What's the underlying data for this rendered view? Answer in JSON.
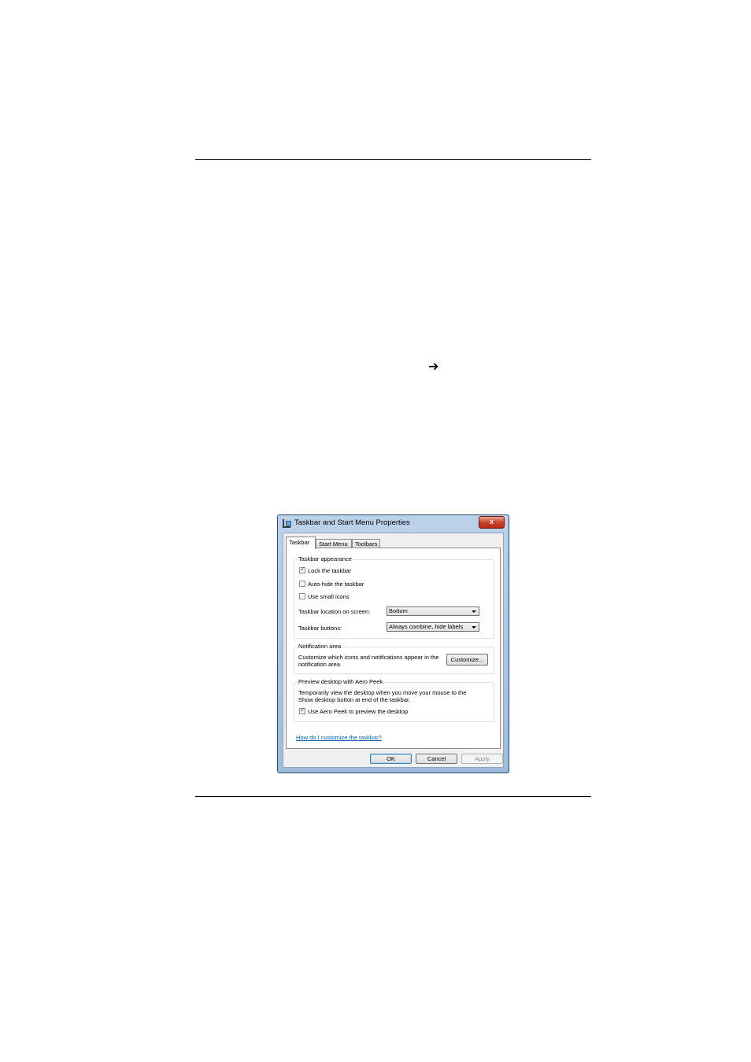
{
  "page": {
    "arrow_glyph": "➔"
  },
  "dialog": {
    "title": "Taskbar and Start Menu Properties",
    "close_label": "x",
    "tabs": [
      {
        "label": "Taskbar",
        "active": true
      },
      {
        "label": "Start Menu",
        "active": false
      },
      {
        "label": "Toolbars",
        "active": false
      }
    ],
    "taskbar_appearance": {
      "legend": "Taskbar appearance",
      "lock_taskbar": {
        "label": "Lock the taskbar",
        "checked": true
      },
      "auto_hide": {
        "label": "Auto-hide the taskbar",
        "checked": false
      },
      "small_icons": {
        "label": "Use small icons",
        "checked": false
      },
      "location_label": "Taskbar location on screen:",
      "location_value": "Bottom",
      "buttons_label": "Taskbar buttons:",
      "buttons_value": "Always combine, hide labels"
    },
    "notification_area": {
      "legend": "Notification area",
      "description_line1": "Customize which icons and notifications appear in the",
      "description_line2": "notification area.",
      "customize_label": "Customize..."
    },
    "aero_peek": {
      "legend": "Preview desktop with Aero Peek",
      "description_line1": "Temporarily view the desktop when you move your mouse to the",
      "description_line2": "Show desktop button at end of the taskbar.",
      "use_aero_peek": {
        "label": "Use Aero Peek to preview the desktop",
        "checked": true
      }
    },
    "help_link": "How do I customize the taskbar?",
    "ok_label": "OK",
    "cancel_label": "Cancel",
    "apply_label": "Apply"
  }
}
